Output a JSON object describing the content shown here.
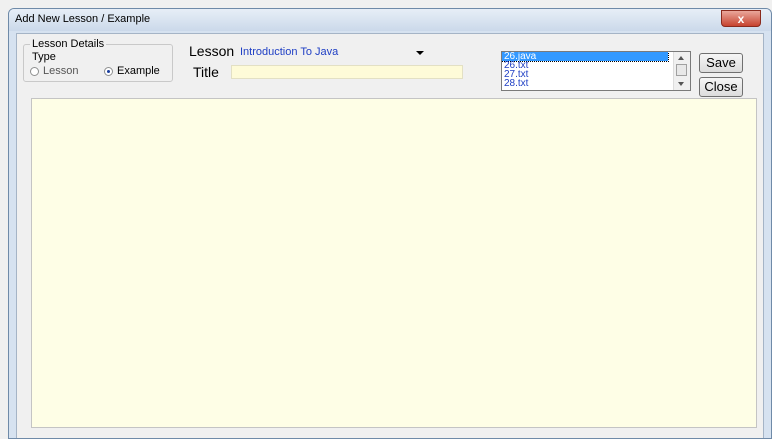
{
  "window": {
    "title": "Add New Lesson / Example",
    "close_glyph": "x"
  },
  "details": {
    "group_label": "Lesson Details",
    "type_label": "Type",
    "radio_lesson": "Lesson",
    "radio_example": "Example",
    "selected_type": "Example"
  },
  "lesson": {
    "label": "Lesson",
    "value": "Introduction To Java"
  },
  "title": {
    "label": "Title",
    "value": ""
  },
  "files": {
    "items": [
      "26.java",
      "26.txt",
      "27.txt",
      "28.txt"
    ],
    "selected_index": 0
  },
  "buttons": {
    "save": "Save",
    "close": "Close"
  },
  "editor": {
    "content": ""
  }
}
